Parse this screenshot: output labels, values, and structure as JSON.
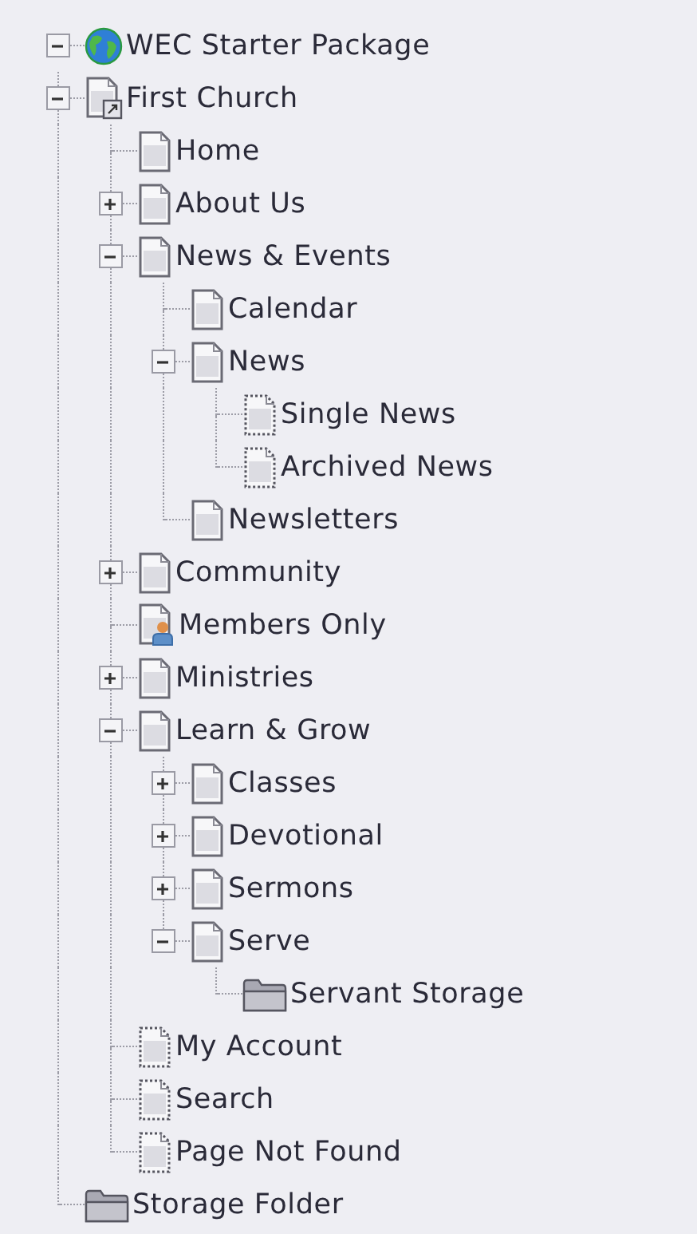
{
  "tree": {
    "label": "WEC Starter Package",
    "kind": "site",
    "expanded": true,
    "children": [
      {
        "label": "First Church",
        "kind": "shortcut",
        "expanded": true,
        "children": [
          {
            "label": "Home",
            "kind": "page"
          },
          {
            "label": "About Us",
            "kind": "page",
            "expanded": false
          },
          {
            "label": "News & Events",
            "kind": "page",
            "expanded": true,
            "children": [
              {
                "label": "Calendar",
                "kind": "page"
              },
              {
                "label": "News",
                "kind": "page",
                "expanded": true,
                "children": [
                  {
                    "label": "Single News",
                    "kind": "hidden"
                  },
                  {
                    "label": "Archived News",
                    "kind": "hidden"
                  }
                ]
              },
              {
                "label": "Newsletters",
                "kind": "page"
              }
            ]
          },
          {
            "label": "Community",
            "kind": "page",
            "expanded": false
          },
          {
            "label": "Members Only",
            "kind": "members"
          },
          {
            "label": "Ministries",
            "kind": "page",
            "expanded": false
          },
          {
            "label": "Learn & Grow",
            "kind": "page",
            "expanded": true,
            "children": [
              {
                "label": "Classes",
                "kind": "page",
                "expanded": false
              },
              {
                "label": "Devotional",
                "kind": "page",
                "expanded": false
              },
              {
                "label": "Sermons",
                "kind": "page",
                "expanded": false
              },
              {
                "label": "Serve",
                "kind": "page",
                "expanded": true,
                "children": [
                  {
                    "label": "Servant Storage",
                    "kind": "folder"
                  }
                ]
              }
            ]
          },
          {
            "label": "My Account",
            "kind": "hidden"
          },
          {
            "label": "Search",
            "kind": "hidden"
          },
          {
            "label": "Page Not Found",
            "kind": "hidden"
          }
        ]
      },
      {
        "label": "Storage Folder",
        "kind": "folder"
      }
    ]
  }
}
